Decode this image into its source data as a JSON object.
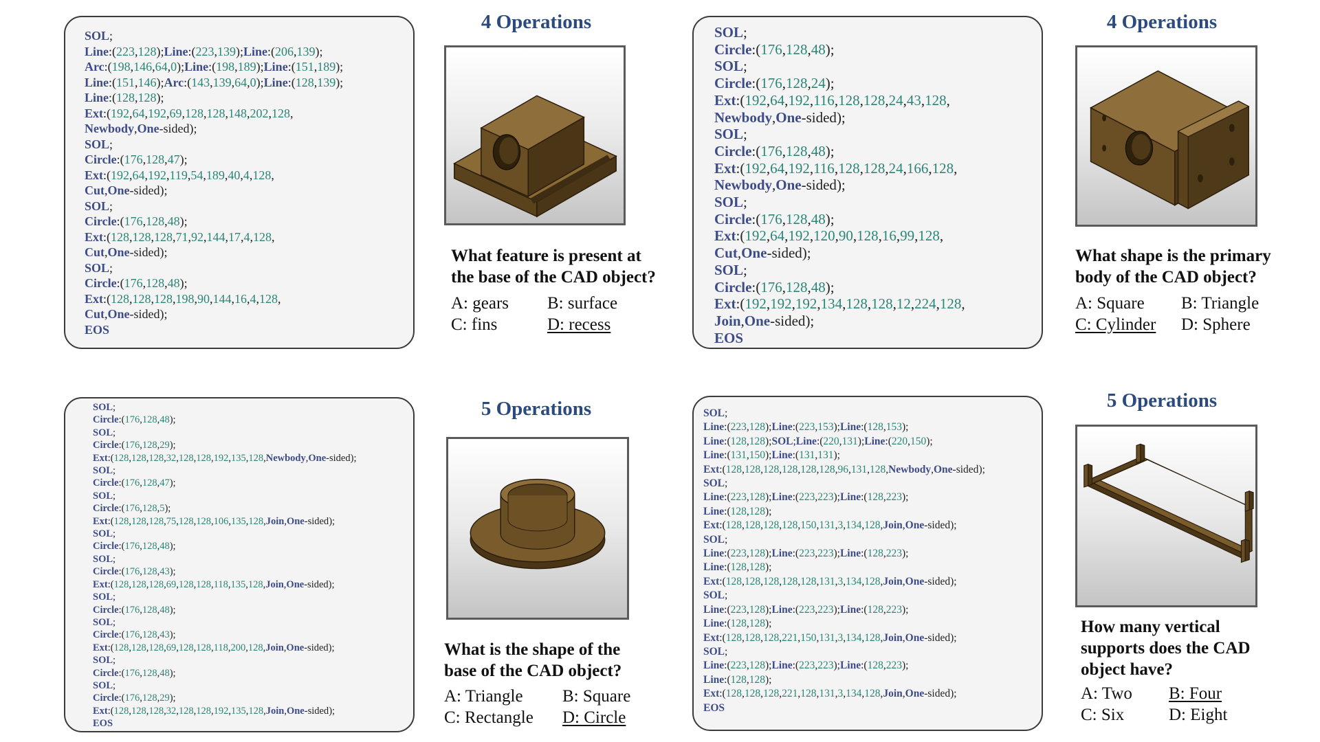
{
  "panels": [
    {
      "code": [
        "SOL;",
        "Line:(223,128);Line:(223,139);Line:(206,139);",
        "Arc:(198,146,64,0);Line:(198,189);Line:(151,189);",
        "Line:(151,146);Arc:(143,139,64,0);Line:(128,139);",
        "Line:(128,128);",
        "Ext:(192,64,192,69,128,128,148,202,128,",
        "Newbody,One-sided);",
        "SOL;",
        "Circle:(176,128,47);",
        "Ext:(192,64,192,119,54,189,40,4,128,",
        "Cut,One-sided);",
        "SOL;",
        "Circle:(176,128,48);",
        "Ext:(128,128,128,71,92,144,17,4,128,",
        "Cut,One-sided);",
        "SOL;",
        "Circle:(176,128,48);",
        "Ext:(128,128,128,198,90,144,16,4,128,",
        "Cut,One-sided);",
        "EOS"
      ],
      "title": "4 Operations",
      "question": "What feature is present at\nthe base of the CAD object?",
      "options": [
        "A: gears",
        "B: surface",
        "C: fins",
        "D: recess"
      ],
      "answer_index": 3
    },
    {
      "code": [
        "SOL;",
        "Circle:(176,128,48);",
        "SOL;",
        "Circle:(176,128,24);",
        "Ext:(192,64,192,116,128,128,24,43,128,",
        "Newbody,One-sided);",
        "SOL;",
        "Circle:(176,128,48);",
        "Ext:(192,64,192,116,128,128,24,166,128,",
        "Newbody,One-sided);",
        "SOL;",
        "Circle:(176,128,48);",
        "Ext:(192,64,192,120,90,128,16,99,128,",
        "Cut,One-sided);",
        "SOL;",
        "Circle:(176,128,48);",
        "Ext:(192,192,192,134,128,128,12,224,128,",
        "Join,One-sided);",
        "EOS"
      ],
      "title": "4 Operations",
      "question": "What shape is the primary\nbody of the CAD object?",
      "options": [
        "A: Square",
        "B: Triangle",
        "C: Cylinder",
        "D: Sphere"
      ],
      "answer_index": 2
    },
    {
      "code": [
        "SOL;",
        "Circle:(176,128,48);",
        "SOL;",
        "Circle:(176,128,29);",
        "Ext:(128,128,128,32,128,128,192,135,128,Newbody,One-sided);",
        "SOL;",
        "Circle:(176,128,47);",
        "SOL;",
        "Circle:(176,128,5);",
        "Ext:(128,128,128,75,128,128,106,135,128,Join,One-sided);",
        "SOL;",
        "Circle:(176,128,48);",
        "SOL;",
        "Circle:(176,128,43);",
        "Ext:(128,128,128,69,128,128,118,135,128,Join,One-sided);",
        "SOL;",
        "Circle:(176,128,48);",
        "SOL;",
        "Circle:(176,128,43);",
        "Ext:(128,128,128,69,128,128,118,200,128,Join,One-sided);",
        "SOL;",
        "Circle:(176,128,48);",
        "SOL;",
        "Circle:(176,128,29);",
        "Ext:(128,128,128,32,128,128,192,135,128,Join,One-sided);",
        "EOS"
      ],
      "title": "5 Operations",
      "question": "What is the shape of the\nbase of the CAD object?",
      "options": [
        "A: Triangle",
        "B: Square",
        "C: Rectangle",
        "D: Circle"
      ],
      "answer_index": 3
    },
    {
      "code": [
        "SOL;",
        "Line:(223,128);Line:(223,153);Line:(128,153);",
        "Line:(128,128);SOL;Line:(220,131);Line:(220,150);",
        "Line:(131,150);Line:(131,131);",
        "Ext:(128,128,128,128,128,128,96,131,128,Newbody,One-sided);",
        "SOL;",
        "Line:(223,128);Line:(223,223);Line:(128,223);",
        "Line:(128,128);",
        "Ext:(128,128,128,128,150,131,3,134,128,Join,One-sided);",
        "SOL;",
        "Line:(223,128);Line:(223,223);Line:(128,223);",
        "Line:(128,128);",
        "Ext:(128,128,128,128,128,131,3,134,128,Join,One-sided);",
        "SOL;",
        "Line:(223,128);Line:(223,223);Line:(128,223);",
        "Line:(128,128);",
        "Ext:(128,128,128,221,150,131,3,134,128,Join,One-sided);",
        "SOL;",
        "Line:(223,128);Line:(223,223);Line:(128,223);",
        "Line:(128,128);",
        "Ext:(128,128,128,221,128,131,3,134,128,Join,One-sided);",
        "EOS"
      ],
      "title": "5 Operations",
      "question": "How many vertical\nsupports does the CAD\nobject have?",
      "options": [
        "A: Two",
        "B: Four",
        "C: Six",
        "D: Eight"
      ],
      "answer_index": 1
    }
  ],
  "colors": {
    "keyword": "#3d4c86",
    "number": "#2a8577",
    "title": "#2b4a7d",
    "model": "#5e4520"
  },
  "icons": [
    "bracket-model",
    "block-with-cylinder-model",
    "flanged-bushing-model",
    "rectangular-frame-model"
  ]
}
